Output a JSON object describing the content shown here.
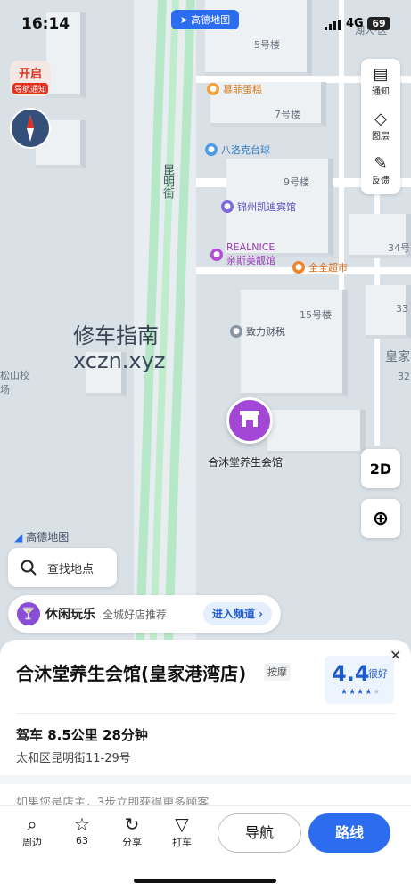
{
  "status_bar": {
    "time": "16:14",
    "network": "4G",
    "battery": "69"
  },
  "map": {
    "brand_pill": "高德地图",
    "road_name": "昆明街",
    "top_right_partial": "湖人·区",
    "nav_badge": {
      "line1": "开启",
      "line2": "导航通知"
    },
    "building_labels": [
      "5号楼",
      "7号楼",
      "9号楼",
      "15号楼",
      "34号",
      "33",
      "32"
    ],
    "left_partial": "松山校\n场",
    "right_partial": "皇家",
    "pois": [
      {
        "name": "慕菲蛋糕",
        "color": "#f0a13a"
      },
      {
        "name": "八洛克台球",
        "color": "#4a9ce8"
      },
      {
        "name": "锦州凯迪宾馆",
        "color": "#7d6ad8"
      },
      {
        "name": "REALNICE\n亲斯美靓馆",
        "color": "#b14fd0"
      },
      {
        "name": "全全超市",
        "color": "#f0862c"
      },
      {
        "name": "致力财税",
        "color": "#8894a3"
      }
    ],
    "pin_label": "合沐堂养生会馆",
    "watermark_line1": "修车指南",
    "watermark_line2": "xczn.xyz",
    "amap_brand": "高德地图",
    "tools": [
      {
        "label": "通知",
        "icon": "notice-icon"
      },
      {
        "label": "图层",
        "icon": "layers-icon"
      },
      {
        "label": "反馈",
        "icon": "feedback-icon"
      }
    ],
    "view_toggle": "2D",
    "search_placeholder": "查找地点",
    "leisure": {
      "title": "休闲玩乐",
      "subtitle": "全城好店推荐",
      "enter": "进入频道 ›"
    }
  },
  "place": {
    "title": "合沐堂养生会馆(皇家港湾店)",
    "tag": "按摩",
    "rating": "4.4",
    "rating_label": "很好",
    "rating_stars": 4,
    "drive": "驾车 8.5公里  28分钟",
    "address": "太和区昆明街11-29号",
    "hint": "如果您是店主，3步立即获得更多顾客"
  },
  "bottom_actions": [
    {
      "label": "周边",
      "icon": "search-icon"
    },
    {
      "label": "63",
      "icon": "star-icon"
    },
    {
      "label": "分享",
      "icon": "share-icon"
    },
    {
      "label": "打车",
      "icon": "taxi-icon"
    }
  ],
  "buttons": {
    "navigate": "导航",
    "route": "路线"
  }
}
